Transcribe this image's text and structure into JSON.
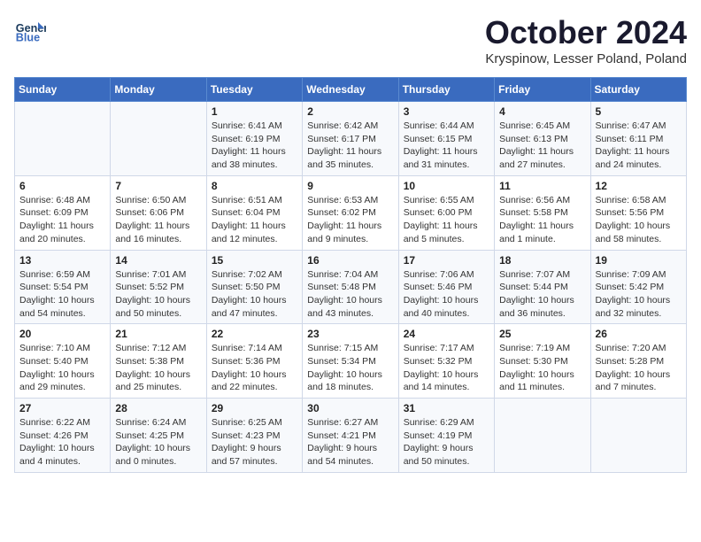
{
  "header": {
    "logo_line1": "General",
    "logo_line2": "Blue",
    "month_title": "October 2024",
    "subtitle": "Kryspinow, Lesser Poland, Poland"
  },
  "days_of_week": [
    "Sunday",
    "Monday",
    "Tuesday",
    "Wednesday",
    "Thursday",
    "Friday",
    "Saturday"
  ],
  "weeks": [
    [
      {
        "day": "",
        "detail": ""
      },
      {
        "day": "",
        "detail": ""
      },
      {
        "day": "1",
        "detail": "Sunrise: 6:41 AM\nSunset: 6:19 PM\nDaylight: 11 hours and 38 minutes."
      },
      {
        "day": "2",
        "detail": "Sunrise: 6:42 AM\nSunset: 6:17 PM\nDaylight: 11 hours and 35 minutes."
      },
      {
        "day": "3",
        "detail": "Sunrise: 6:44 AM\nSunset: 6:15 PM\nDaylight: 11 hours and 31 minutes."
      },
      {
        "day": "4",
        "detail": "Sunrise: 6:45 AM\nSunset: 6:13 PM\nDaylight: 11 hours and 27 minutes."
      },
      {
        "day": "5",
        "detail": "Sunrise: 6:47 AM\nSunset: 6:11 PM\nDaylight: 11 hours and 24 minutes."
      }
    ],
    [
      {
        "day": "6",
        "detail": "Sunrise: 6:48 AM\nSunset: 6:09 PM\nDaylight: 11 hours and 20 minutes."
      },
      {
        "day": "7",
        "detail": "Sunrise: 6:50 AM\nSunset: 6:06 PM\nDaylight: 11 hours and 16 minutes."
      },
      {
        "day": "8",
        "detail": "Sunrise: 6:51 AM\nSunset: 6:04 PM\nDaylight: 11 hours and 12 minutes."
      },
      {
        "day": "9",
        "detail": "Sunrise: 6:53 AM\nSunset: 6:02 PM\nDaylight: 11 hours and 9 minutes."
      },
      {
        "day": "10",
        "detail": "Sunrise: 6:55 AM\nSunset: 6:00 PM\nDaylight: 11 hours and 5 minutes."
      },
      {
        "day": "11",
        "detail": "Sunrise: 6:56 AM\nSunset: 5:58 PM\nDaylight: 11 hours and 1 minute."
      },
      {
        "day": "12",
        "detail": "Sunrise: 6:58 AM\nSunset: 5:56 PM\nDaylight: 10 hours and 58 minutes."
      }
    ],
    [
      {
        "day": "13",
        "detail": "Sunrise: 6:59 AM\nSunset: 5:54 PM\nDaylight: 10 hours and 54 minutes."
      },
      {
        "day": "14",
        "detail": "Sunrise: 7:01 AM\nSunset: 5:52 PM\nDaylight: 10 hours and 50 minutes."
      },
      {
        "day": "15",
        "detail": "Sunrise: 7:02 AM\nSunset: 5:50 PM\nDaylight: 10 hours and 47 minutes."
      },
      {
        "day": "16",
        "detail": "Sunrise: 7:04 AM\nSunset: 5:48 PM\nDaylight: 10 hours and 43 minutes."
      },
      {
        "day": "17",
        "detail": "Sunrise: 7:06 AM\nSunset: 5:46 PM\nDaylight: 10 hours and 40 minutes."
      },
      {
        "day": "18",
        "detail": "Sunrise: 7:07 AM\nSunset: 5:44 PM\nDaylight: 10 hours and 36 minutes."
      },
      {
        "day": "19",
        "detail": "Sunrise: 7:09 AM\nSunset: 5:42 PM\nDaylight: 10 hours and 32 minutes."
      }
    ],
    [
      {
        "day": "20",
        "detail": "Sunrise: 7:10 AM\nSunset: 5:40 PM\nDaylight: 10 hours and 29 minutes."
      },
      {
        "day": "21",
        "detail": "Sunrise: 7:12 AM\nSunset: 5:38 PM\nDaylight: 10 hours and 25 minutes."
      },
      {
        "day": "22",
        "detail": "Sunrise: 7:14 AM\nSunset: 5:36 PM\nDaylight: 10 hours and 22 minutes."
      },
      {
        "day": "23",
        "detail": "Sunrise: 7:15 AM\nSunset: 5:34 PM\nDaylight: 10 hours and 18 minutes."
      },
      {
        "day": "24",
        "detail": "Sunrise: 7:17 AM\nSunset: 5:32 PM\nDaylight: 10 hours and 14 minutes."
      },
      {
        "day": "25",
        "detail": "Sunrise: 7:19 AM\nSunset: 5:30 PM\nDaylight: 10 hours and 11 minutes."
      },
      {
        "day": "26",
        "detail": "Sunrise: 7:20 AM\nSunset: 5:28 PM\nDaylight: 10 hours and 7 minutes."
      }
    ],
    [
      {
        "day": "27",
        "detail": "Sunrise: 6:22 AM\nSunset: 4:26 PM\nDaylight: 10 hours and 4 minutes."
      },
      {
        "day": "28",
        "detail": "Sunrise: 6:24 AM\nSunset: 4:25 PM\nDaylight: 10 hours and 0 minutes."
      },
      {
        "day": "29",
        "detail": "Sunrise: 6:25 AM\nSunset: 4:23 PM\nDaylight: 9 hours and 57 minutes."
      },
      {
        "day": "30",
        "detail": "Sunrise: 6:27 AM\nSunset: 4:21 PM\nDaylight: 9 hours and 54 minutes."
      },
      {
        "day": "31",
        "detail": "Sunrise: 6:29 AM\nSunset: 4:19 PM\nDaylight: 9 hours and 50 minutes."
      },
      {
        "day": "",
        "detail": ""
      },
      {
        "day": "",
        "detail": ""
      }
    ]
  ]
}
